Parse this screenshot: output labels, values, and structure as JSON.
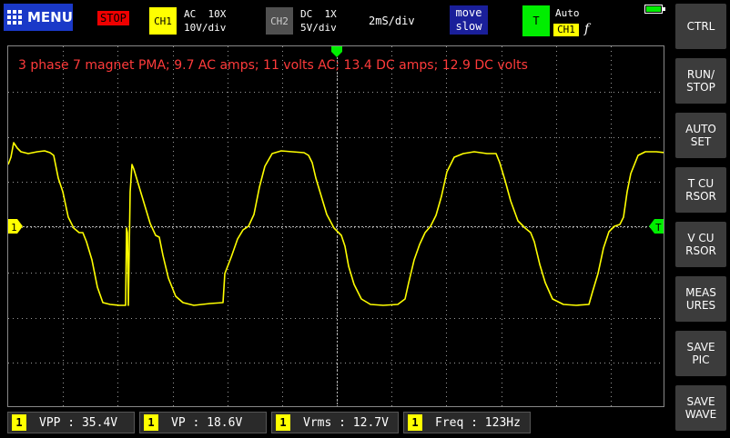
{
  "topbar": {
    "menu_label": "MENU",
    "run_state": "STOP",
    "ch1": {
      "chip": "CH1",
      "coupling": "AC",
      "probe": "10X",
      "scale": "10V/div"
    },
    "ch2": {
      "chip": "CH2",
      "coupling": "DC",
      "probe": "1X",
      "scale": "5V/div"
    },
    "timebase": "2mS/div",
    "move": {
      "line1": "move",
      "line2": "slow"
    },
    "trigger": {
      "chip": "T",
      "mode": "Auto",
      "source": "CH1",
      "edge": "f"
    },
    "battery_icon": "battery-icon"
  },
  "screen": {
    "annotation": "3 phase 7 magnet PMA; 9.7 AC amps; 11 volts AC; 13.4 DC amps; 12.9 DC volts",
    "ch1_marker": "1",
    "trigger_marker": "T",
    "trace_color": "#ffff00",
    "grid_color": "#9a9a9a"
  },
  "right_panel": {
    "buttons": [
      "CTRL",
      "RUN/\nSTOP",
      "AUTO\nSET",
      "T CU\nRSOR",
      "V CU\nRSOR",
      "MEAS\nURES",
      "SAVE\nPIC",
      "SAVE\nWAVE"
    ]
  },
  "measurements": [
    {
      "tag": "1",
      "label": "VPP",
      "value": "35.4V"
    },
    {
      "tag": "1",
      "label": "VP",
      "value": "18.6V"
    },
    {
      "tag": "1",
      "label": "Vrms",
      "value": "12.7V"
    },
    {
      "tag": "1",
      "label": "Freq",
      "value": "123Hz"
    }
  ]
}
